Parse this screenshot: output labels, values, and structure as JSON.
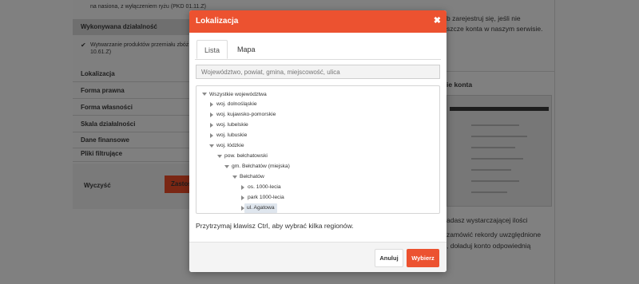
{
  "background": {
    "sidebar": {
      "top_text": "na nasiona, z wyłączeniem ryżu (PKD 01.11.Z)",
      "section_title": "Wykonywana działalność",
      "activity_item": "Wytwarzanie produktów przemiału zbóż",
      "activity_code": "10.61.Z)",
      "filters": [
        "Lokalizacja",
        "Forma prawna",
        "Forma własności",
        "Skala działalności",
        "Dane finansowe",
        "Pliki filtrujące"
      ],
      "clear_label": "Wyczyść",
      "apply_label": "Zastos"
    },
    "right": {
      "text_top_1": "b zarejestruj się, jeśli nie",
      "text_top_2": "szcze konta w naszym serwisie.",
      "section_title": "ie konta",
      "text_bottom_1": "adasz wystarczającej ilości",
      "text_bottom_2": "zamówić rekordy uwzględnione",
      "text_bottom_3": ", doładuj konto odpowiednią"
    }
  },
  "modal": {
    "title": "Lokalizacja",
    "close_icon": "close-icon",
    "tabs": [
      {
        "label": "Lista",
        "active": true
      },
      {
        "label": "Mapa",
        "active": false
      }
    ],
    "search_placeholder": "Województwo, powiat, gmina, miejscowość, ulica",
    "tree": {
      "root": "Wszystkie województwa",
      "voivodeships": [
        "woj. dolnośląskie",
        "woj. kujawsko-pomorskie",
        "woj. lubelskie",
        "woj. lubuskie",
        "woj. łódzkie"
      ],
      "county": "pow. bełchatowski",
      "commune": "gm. Bełchatów (miejska)",
      "town": "Bełchatów",
      "streets": [
        "os. 1000-lecia",
        "park 1000-lecia",
        "ul. Agatowa"
      ]
    },
    "hint": "Przytrzymaj klawisz Ctrl, aby wybrać kilka regionów.",
    "cancel_label": "Anuluj",
    "choose_label": "Wybierz"
  },
  "colors": {
    "accent": "#ec5230",
    "overlay": "#808080",
    "selected_node": "#dfe6ee"
  }
}
